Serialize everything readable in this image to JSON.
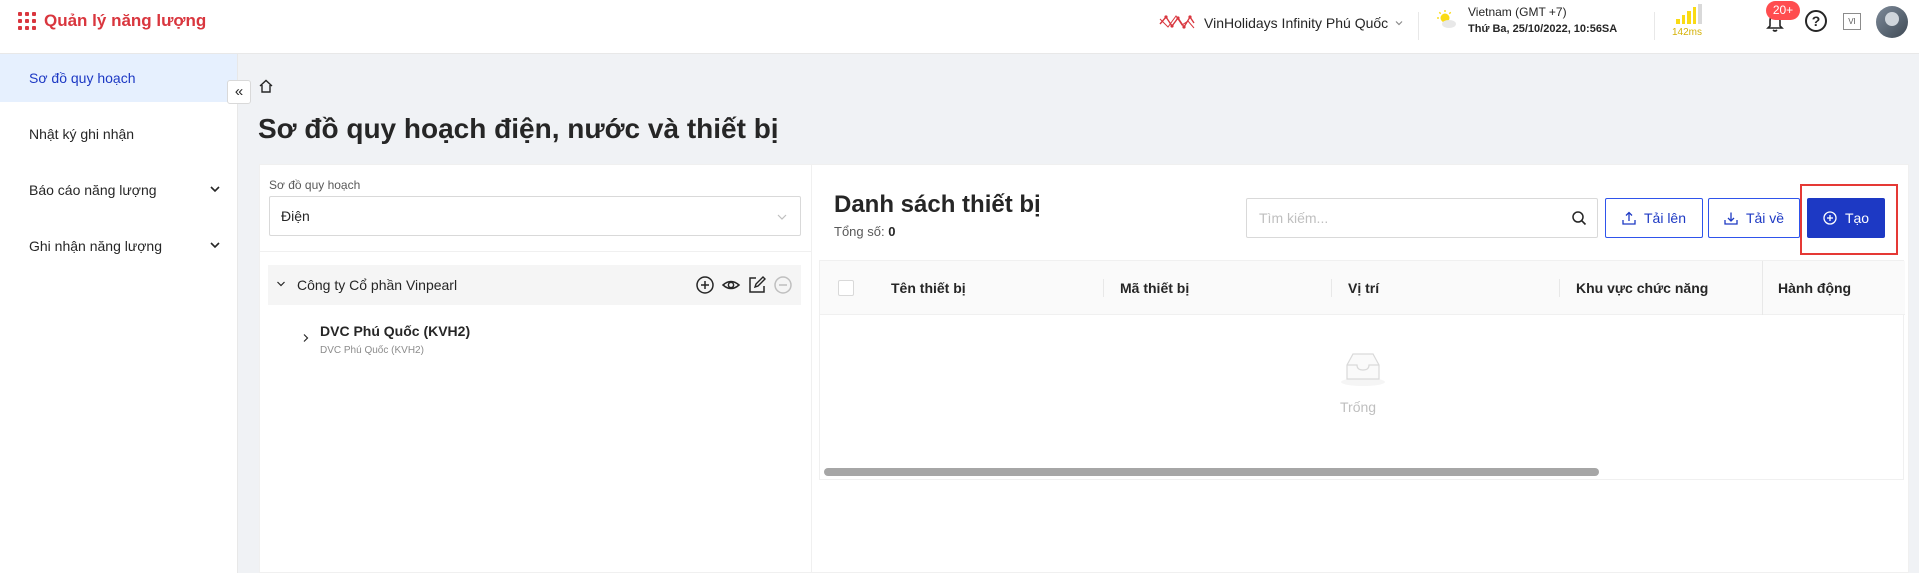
{
  "header": {
    "app_title": "Quản lý năng lượng",
    "hotel_name": "VinHolidays Infinity Phú Quốc",
    "timezone": "Vietnam (GMT +7)",
    "datetime": "Thứ Ba, 25/10/2022, 10:56SA",
    "latency": "142ms",
    "notification_badge": "20+",
    "help_label": "?",
    "language": "VI"
  },
  "sidebar": {
    "items": [
      {
        "label": "Sơ đồ quy hoạch",
        "active": true
      },
      {
        "label": "Nhật ký ghi nhận",
        "active": false
      },
      {
        "label": "Báo cáo năng lượng",
        "active": false,
        "expandable": true
      },
      {
        "label": "Ghi nhận năng lượng",
        "active": false,
        "expandable": true
      }
    ],
    "collapse_glyph": "«"
  },
  "page": {
    "title": "Sơ đồ quy hoạch điện, nước và thiết bị"
  },
  "left_panel": {
    "field_label": "Sơ đồ quy hoạch",
    "selected_value": "Điện",
    "tree": [
      {
        "label": "Công ty Cổ phần Vinpearl",
        "expanded": true
      },
      {
        "label": "DVC Phú Quốc (KVH2)",
        "sublabel": "DVC Phú Quốc (KVH2)",
        "expanded": false
      }
    ]
  },
  "right_panel": {
    "title": "Danh sách thiết bị",
    "total_label": "Tổng số:",
    "total_value": "0",
    "search_placeholder": "Tìm kiếm...",
    "upload_label": "Tải lên",
    "download_label": "Tải về",
    "create_label": "Tạo",
    "columns": [
      "Tên thiết bị",
      "Mã thiết bị",
      "Vị trí",
      "Khu vực chức năng",
      "Hành động"
    ],
    "empty_text": "Trống"
  },
  "colors": {
    "brand": "#d9363e",
    "primary": "#1d39c4",
    "highlight": "#e53935",
    "active_bg": "#e6f0fe"
  }
}
